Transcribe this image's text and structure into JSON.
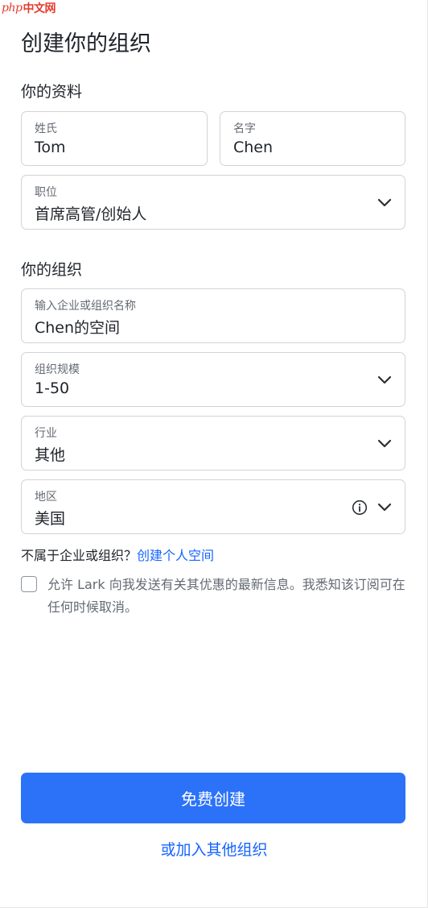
{
  "watermark": {
    "prefix": "php",
    "text": "中文网"
  },
  "page_title": "创建你的组织",
  "profile": {
    "section_title": "你的资料",
    "last_name": {
      "label": "姓氏",
      "value": "Tom"
    },
    "first_name": {
      "label": "名字",
      "value": "Chen"
    },
    "position": {
      "label": "职位",
      "value": "首席高管/创始人"
    }
  },
  "organization": {
    "section_title": "你的组织",
    "name": {
      "label": "输入企业或组织名称",
      "value": "Chen的空间"
    },
    "size": {
      "label": "组织规模",
      "value": "1-50"
    },
    "industry": {
      "label": "行业",
      "value": "其他"
    },
    "region": {
      "label": "地区",
      "value": "美国"
    }
  },
  "personal": {
    "question": "不属于企业或组织？",
    "link": "创建个人空间"
  },
  "consent": {
    "checked": false,
    "text": "允许 Lark 向我发送有关其优惠的最新信息。我悉知该订阅可在任何时候取消。"
  },
  "actions": {
    "create_label": "免费创建",
    "join_label": "或加入其他组织"
  },
  "colors": {
    "accent": "#2b72f9",
    "link": "#1664ff",
    "border": "#d0d3d6"
  },
  "icons": [
    "chevron-down-icon",
    "info-icon",
    "checkbox-icon"
  ]
}
